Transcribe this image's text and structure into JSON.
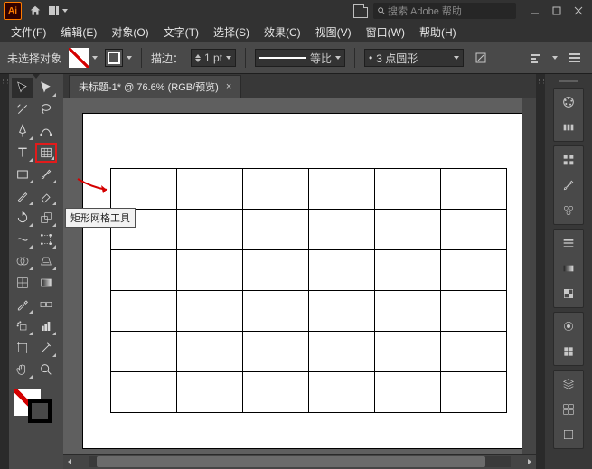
{
  "titlebar": {
    "logo": "Ai",
    "search_placeholder": "搜索 Adobe 帮助"
  },
  "menu": {
    "file": "文件(F)",
    "edit": "编辑(E)",
    "object": "对象(O)",
    "type": "文字(T)",
    "select": "选择(S)",
    "effect": "效果(C)",
    "view": "视图(V)",
    "window": "窗口(W)",
    "help": "帮助(H)"
  },
  "ctrl": {
    "noselection": "未选择对象",
    "stroke_label": "描边：",
    "stroke_value": "1 pt",
    "uniform": "等比",
    "brush": "3 点圆形"
  },
  "tab": {
    "title": "未标题-1* @ 76.6% (RGB/预览)"
  },
  "tooltip": {
    "text": "矩形网格工具"
  },
  "dot": "•"
}
